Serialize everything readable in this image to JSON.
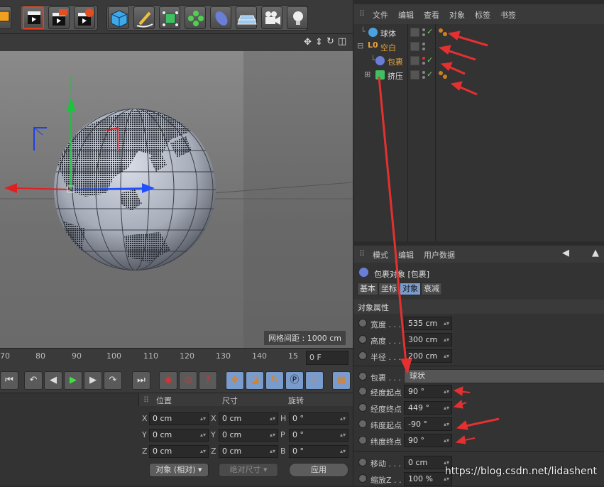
{
  "toolbar": {
    "icons": [
      "cube-edge-icon",
      "render-view-icon",
      "render-picture-queue-icon",
      "render-settings-icon",
      "cube-primitive-icon",
      "pen-spline-icon",
      "subdivision-icon",
      "array-generator-icon",
      "deformer-icon",
      "floor-scene-icon",
      "camera-icon",
      "light-bulb-icon"
    ]
  },
  "viewport": {
    "grid_spacing": "网格间距 : 1000 cm",
    "colors": {
      "x_axis": "#e02020",
      "y_axis": "#20c040",
      "z_axis": "#2050ff"
    }
  },
  "timeline": {
    "ticks": [
      "70",
      "80",
      "90",
      "100",
      "110",
      "120",
      "130",
      "140",
      "15"
    ],
    "current_frame": "0 F"
  },
  "coords": {
    "headers": {
      "position": "位置",
      "size": "尺寸",
      "rotation": "旋转"
    },
    "position_rows": [
      {
        "axis": "X",
        "value": "0 cm"
      },
      {
        "axis": "Y",
        "value": "0 cm"
      },
      {
        "axis": "Z",
        "value": "0 cm"
      }
    ],
    "size_rows": [
      {
        "axis": "X",
        "value": "0 cm"
      },
      {
        "axis": "Y",
        "value": "0 cm"
      },
      {
        "axis": "Z",
        "value": "0 cm"
      }
    ],
    "rotation_rows": [
      {
        "axis": "H",
        "value": "0 °"
      },
      {
        "axis": "P",
        "value": "0 °"
      },
      {
        "axis": "B",
        "value": "0 °"
      }
    ],
    "mode_select": "对象 (相对)",
    "size_select": "绝对尺寸",
    "apply": "应用"
  },
  "object_manager": {
    "menu": [
      "文件",
      "编辑",
      "查看",
      "对象",
      "标签",
      "书签"
    ],
    "objects": [
      {
        "name": "球体",
        "color": "#dddddd"
      },
      {
        "name": "空白",
        "color": "#e6a23c"
      },
      {
        "name": "包裹",
        "color": "#e6a23c"
      },
      {
        "name": "挤压",
        "color": "#dddddd"
      }
    ]
  },
  "attribute_manager": {
    "menu": [
      "模式",
      "编辑",
      "用户数据"
    ],
    "title": "包裹对象 [包裹]",
    "tabs": [
      "基本",
      "坐标",
      "对象",
      "衰减"
    ],
    "section": "对象属性",
    "params": [
      {
        "label": "宽度 . . .",
        "value": "535 cm"
      },
      {
        "label": "高度 . . .",
        "value": "300 cm"
      },
      {
        "label": "半径 . . .",
        "value": "200 cm"
      }
    ],
    "wrap": {
      "label": "包裹 . . . .",
      "value": "球状"
    },
    "angles": [
      {
        "label": "经度起点",
        "value": "90 °"
      },
      {
        "label": "经度终点",
        "value": "449 °"
      },
      {
        "label": "纬度起点",
        "value": "-90 °"
      },
      {
        "label": "纬度终点",
        "value": "90 °"
      }
    ],
    "extra": [
      {
        "label": "移动 . . .",
        "value": "0 cm"
      },
      {
        "label": "缩放Z . .",
        "value": "100 %"
      }
    ]
  },
  "watermark": "https://blog.csdn.net/lidashent"
}
